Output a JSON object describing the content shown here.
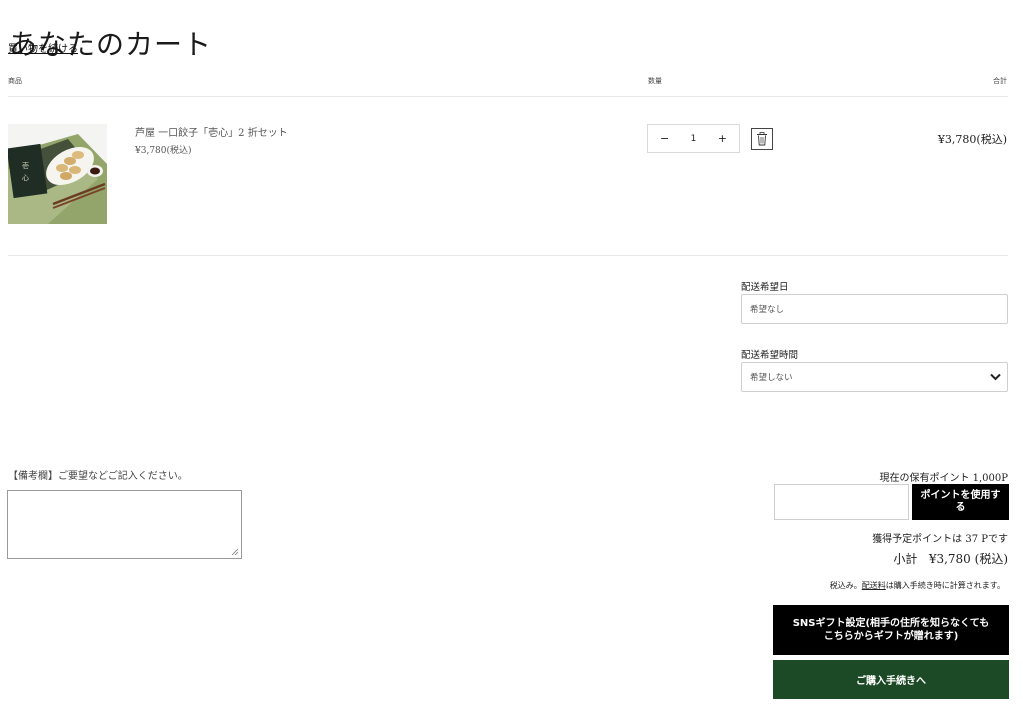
{
  "page": {
    "title": "あなたのカート",
    "continue_link": "買い物を続ける"
  },
  "table": {
    "headers": [
      "商品",
      "数量",
      "合計"
    ]
  },
  "item": {
    "name": "芦屋 一口餃子「壱心」2 折セット",
    "price": "¥3,780(税込)",
    "quantity": "1",
    "line_total": "¥3,780(税込)",
    "decrement": "−",
    "increment": "+"
  },
  "delivery": {
    "date_label": "配送希望日",
    "date_placeholder": "希望なし",
    "time_label": "配送希望時間",
    "time_selected": "希望しない"
  },
  "note": {
    "label": "【備考欄】ご要望などご記入ください。"
  },
  "points": {
    "current": "現在の保有ポイント 1,000P",
    "use_button": "ポイントを使用する",
    "earn": "獲得予定ポイントは 37 Pです"
  },
  "summary": {
    "subtotal_label": "小計",
    "subtotal_value": "¥3,780 (税込)",
    "tax_prefix": "税込み。",
    "shipping_link": "配送料",
    "tax_suffix": "は購入手続き時に計算されます。"
  },
  "buttons": {
    "sns_gift": "SNSギフト設定(相手の住所を知らなくてもこちらからギフトが贈れます)",
    "checkout": "ご購入手続きへ"
  },
  "colors": {
    "checkout_green": "#1d4a26",
    "button_black": "#000000"
  }
}
